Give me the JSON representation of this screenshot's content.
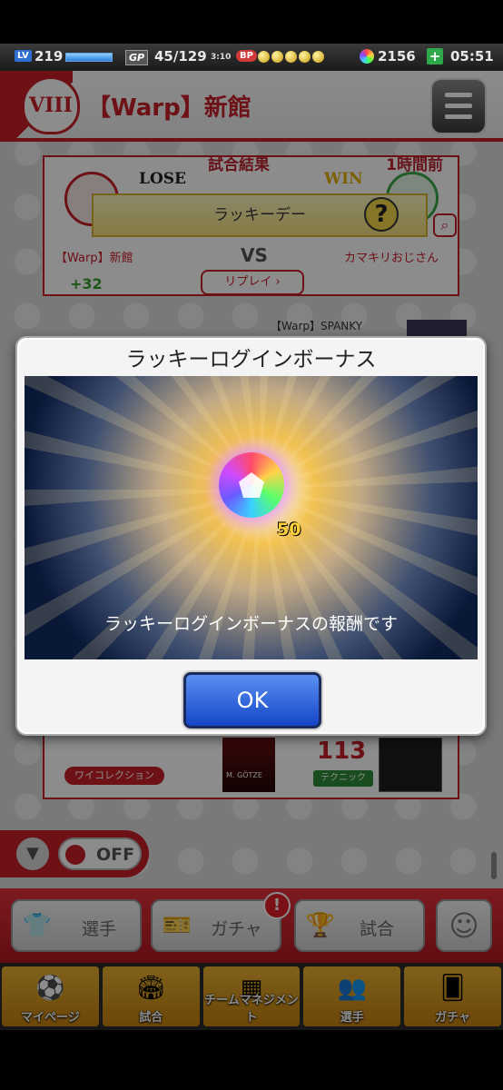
{
  "status": {
    "lv_label": "LV",
    "lv_value": "219",
    "lv_progress": 1.0,
    "gp_label": "GP",
    "gp_value": "45/129",
    "gp_timer": "3:10",
    "bp_label": "BP",
    "bp_count": 5,
    "coins": "2156",
    "plus": "+",
    "time": "05:51"
  },
  "header": {
    "emblem": "VIII",
    "team_name": "【Warp】新館"
  },
  "match": {
    "heading_left": "試合結果",
    "heading_right": "1時間前",
    "lose": "LOSE",
    "win": "WIN",
    "ribbon": "ラッキーデー",
    "help": "?",
    "vs": "VS",
    "left_team": "【Warp】新館",
    "right_team": "カマキリおじさん",
    "delta": "+32",
    "replay": "リプレイ ›"
  },
  "secondary": {
    "spanky": "【Warp】SPANKY"
  },
  "collection": {
    "tag": "ワイコレクション",
    "player_name": "M. GÖTZE",
    "stat_value": "113",
    "stat_tag": "テクニック"
  },
  "filter": {
    "toggle": "OFF"
  },
  "nav": {
    "players": "選手",
    "gacha": "ガチャ",
    "match": "試合",
    "alert": "!"
  },
  "tabs": [
    {
      "label": "マイページ"
    },
    {
      "label": "試合"
    },
    {
      "label": "チームマネジメント"
    },
    {
      "label": "選手"
    },
    {
      "label": "ガチャ"
    }
  ],
  "modal": {
    "title": "ラッキーログインボーナス",
    "reward_qty": "50",
    "message": "ラッキーログインボーナスの報酬です",
    "ok": "OK"
  }
}
